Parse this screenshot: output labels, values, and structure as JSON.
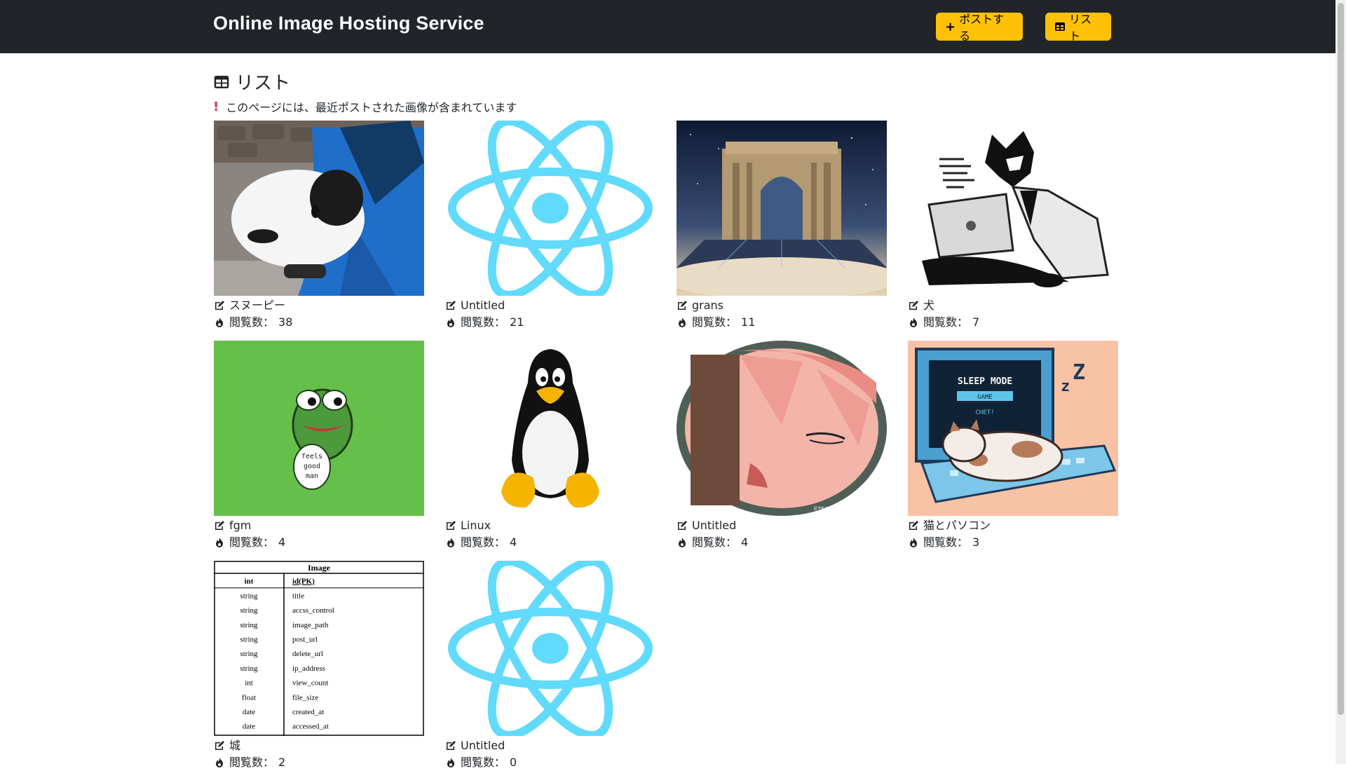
{
  "header": {
    "brand": "Online Image Hosting Service",
    "post_button": "ポストする",
    "list_button": "リスト"
  },
  "page": {
    "heading": "リスト",
    "notice": "このページには、最近ポストされた画像が含まれています"
  },
  "view_label": "閲覧数：",
  "images": [
    {
      "title": "スヌーピー",
      "views": "38",
      "icon": "plush-toy-photo"
    },
    {
      "title": "Untitled",
      "views": "21",
      "icon": "react-atom-logo"
    },
    {
      "title": "grans",
      "views": "11",
      "icon": "fantasy-arch-art"
    },
    {
      "title": "犬",
      "views": "7",
      "icon": "wolf-laptop-sketch"
    },
    {
      "title": "fgm",
      "views": "4",
      "icon": "pepe-frog"
    },
    {
      "title": "Linux",
      "views": "4",
      "icon": "tux-penguin"
    },
    {
      "title": "Untitled",
      "views": "4",
      "icon": "anime-girl-portrait"
    },
    {
      "title": "猫とパソコン",
      "views": "3",
      "icon": "pixel-cat-keyboard"
    },
    {
      "title": "城",
      "views": "2",
      "icon": "er-table-diagram"
    },
    {
      "title": "Untitled",
      "views": "0",
      "icon": "react-atom-logo"
    }
  ],
  "pixel_art_text": {
    "line1": "SLEEP MODE",
    "line2": "GAME",
    "line3": "CHET!"
  },
  "pepe_text": [
    "feels",
    "good",
    "man"
  ],
  "anime_watermark": "©TE/S, SFP",
  "er_table": {
    "name": "Image",
    "rows": [
      {
        "type": "int",
        "field": "id(PK)"
      },
      {
        "type": "string",
        "field": "title"
      },
      {
        "type": "string",
        "field": "accss_control"
      },
      {
        "type": "string",
        "field": "image_path"
      },
      {
        "type": "string",
        "field": "post_url"
      },
      {
        "type": "string",
        "field": "delete_url"
      },
      {
        "type": "string",
        "field": "ip_address"
      },
      {
        "type": "int",
        "field": "view_count"
      },
      {
        "type": "float",
        "field": "file_size"
      },
      {
        "type": "date",
        "field": "created_at"
      },
      {
        "type": "date",
        "field": "accessed_at"
      }
    ]
  },
  "colors": {
    "navbar": "#212529",
    "accent": "#ffc107",
    "react": "#61dafb",
    "pepe_bg": "#65c04a",
    "notice": "#dc3545"
  }
}
